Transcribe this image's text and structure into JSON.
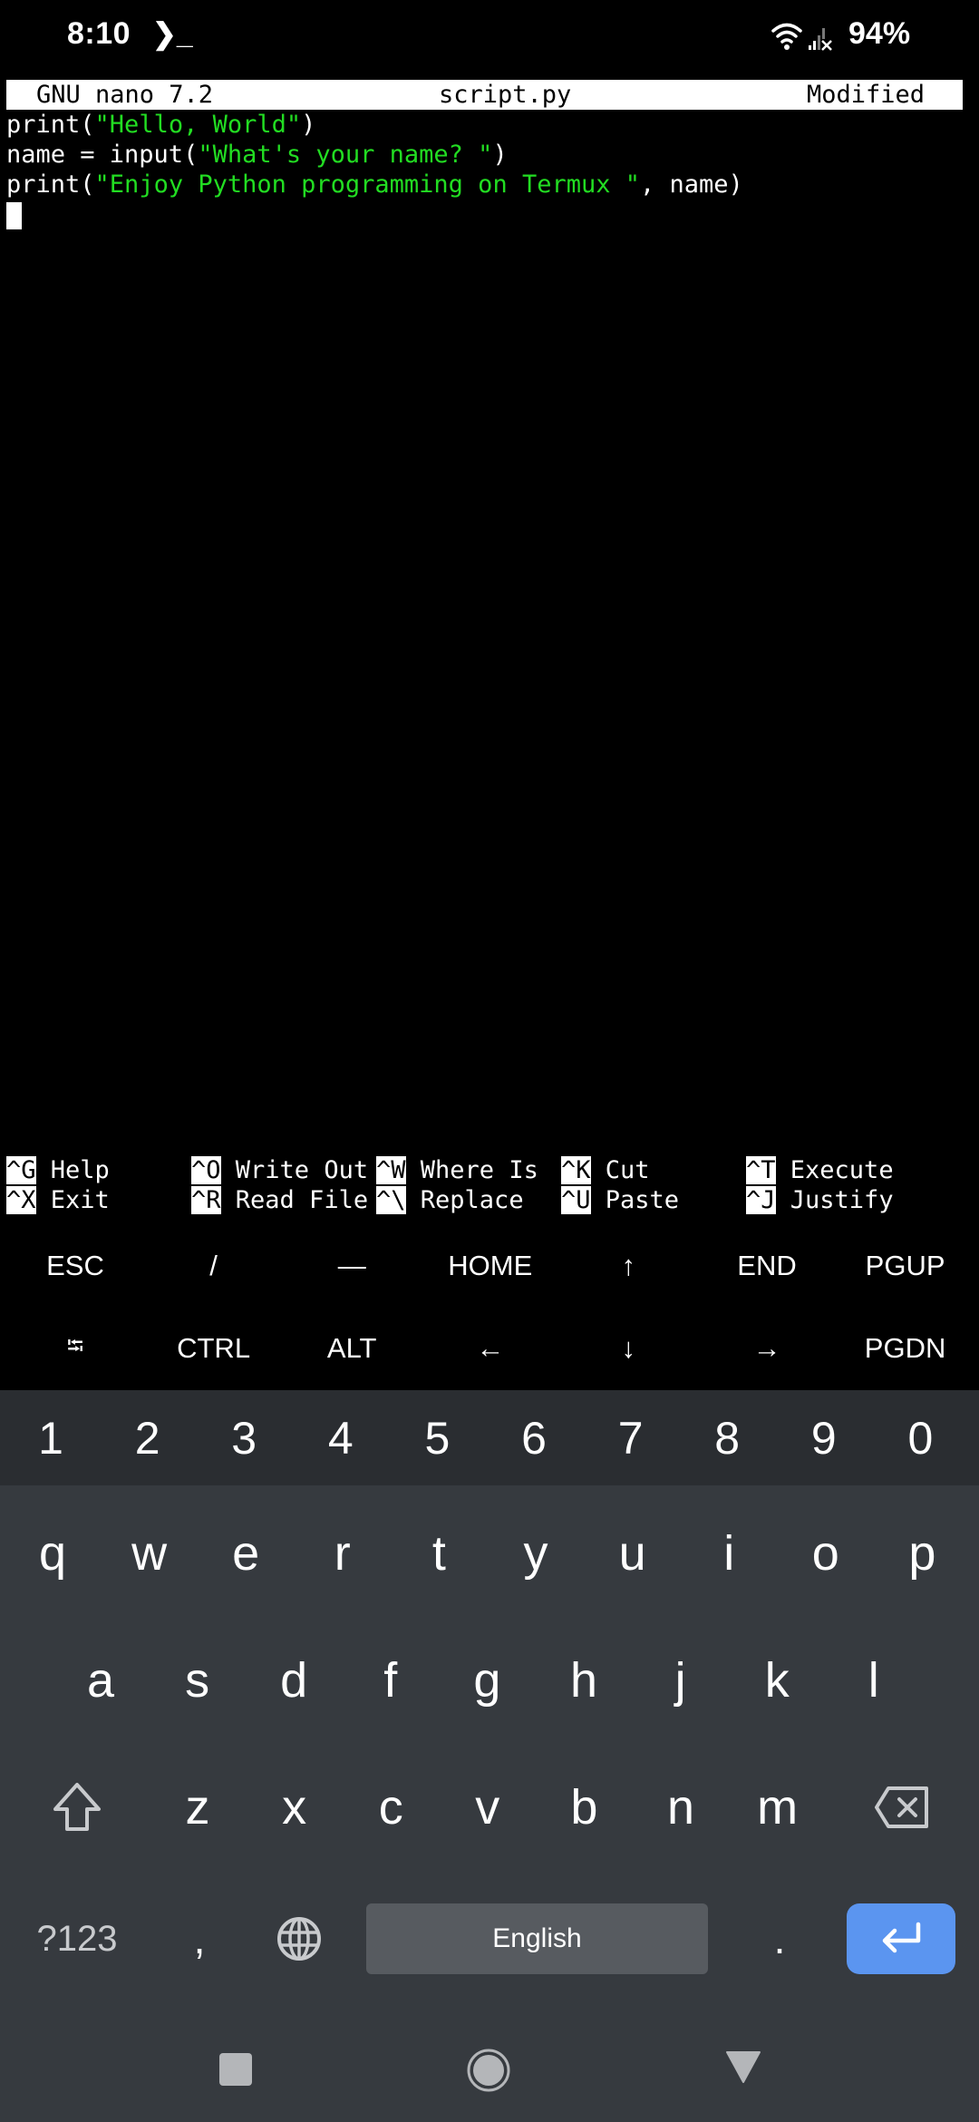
{
  "status_bar": {
    "time": "8:10",
    "notification_icon": "terminal-prompt-icon",
    "notification_glyph": "❯_",
    "wifi_icon": "wifi-icon",
    "signal_icon": "cellular-signal-no-data-icon",
    "battery": "94%"
  },
  "editor": {
    "app": "GNU nano 7.2",
    "filename": "script.py",
    "state": "Modified",
    "lines": [
      [
        {
          "t": "print(",
          "c": "plain"
        },
        {
          "t": "\"Hello, World\"",
          "c": "str"
        },
        {
          "t": ")",
          "c": "plain"
        }
      ],
      [
        {
          "t": "name = input(",
          "c": "plain"
        },
        {
          "t": "\"What's your name? \"",
          "c": "str"
        },
        {
          "t": ")",
          "c": "plain"
        }
      ],
      [
        {
          "t": "print(",
          "c": "plain"
        },
        {
          "t": "\"Enjoy Python programming on Termux \"",
          "c": "str"
        },
        {
          "t": ", name)",
          "c": "plain"
        }
      ]
    ],
    "colors": {
      "string": "#22DD22",
      "text": "#FFFFFF",
      "background": "#000000"
    }
  },
  "shortcuts": [
    {
      "key": "^G",
      "label": "Help"
    },
    {
      "key": "^O",
      "label": "Write Out"
    },
    {
      "key": "^W",
      "label": "Where Is"
    },
    {
      "key": "^K",
      "label": "Cut"
    },
    {
      "key": "^T",
      "label": "Execute"
    },
    {
      "key": "^X",
      "label": "Exit"
    },
    {
      "key": "^R",
      "label": "Read File"
    },
    {
      "key": "^\\",
      "label": "Replace"
    },
    {
      "key": "^U",
      "label": "Paste"
    },
    {
      "key": "^J",
      "label": "Justify"
    }
  ],
  "extra_keys": {
    "row1": [
      "ESC",
      "/",
      "—",
      "HOME",
      "↑",
      "END",
      "PGUP"
    ],
    "row2": [
      "⭾",
      "CTRL",
      "ALT",
      "←",
      "↓",
      "→",
      "PGDN"
    ]
  },
  "keyboard": {
    "numbers": [
      "1",
      "2",
      "3",
      "4",
      "5",
      "6",
      "7",
      "8",
      "9",
      "0"
    ],
    "row1": [
      "q",
      "w",
      "e",
      "r",
      "t",
      "y",
      "u",
      "i",
      "o",
      "p"
    ],
    "row2": [
      "a",
      "s",
      "d",
      "f",
      "g",
      "h",
      "j",
      "k",
      "l"
    ],
    "row3": [
      "z",
      "x",
      "c",
      "v",
      "b",
      "n",
      "m"
    ],
    "symbols_label": "?123",
    "comma": ",",
    "period": ".",
    "space_label": "English",
    "enter_color": "#5B95F0"
  },
  "nav_bar": {
    "recents": "recents-icon",
    "home": "home-icon",
    "back": "back-icon"
  }
}
